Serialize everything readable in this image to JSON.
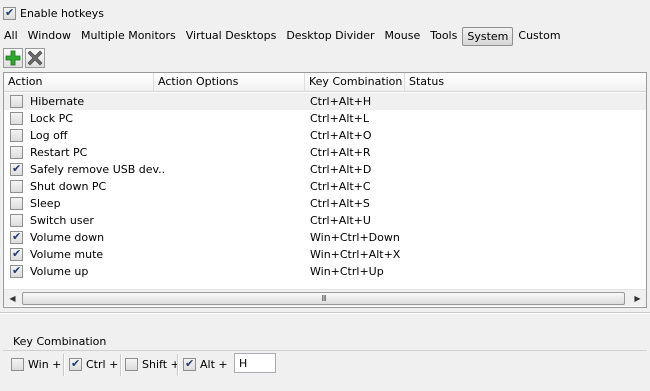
{
  "enable_hotkeys": {
    "label": "Enable hotkeys",
    "checked": true
  },
  "tabs": [
    {
      "label": "All",
      "active": false
    },
    {
      "label": "Window",
      "active": false
    },
    {
      "label": "Multiple Monitors",
      "active": false
    },
    {
      "label": "Virtual Desktops",
      "active": false
    },
    {
      "label": "Desktop Divider",
      "active": false
    },
    {
      "label": "Mouse",
      "active": false
    },
    {
      "label": "Tools",
      "active": false
    },
    {
      "label": "System",
      "active": true
    },
    {
      "label": "Custom",
      "active": false
    }
  ],
  "toolbar": {
    "add_icon": "plus-icon",
    "add_color": "#2eaa2e",
    "delete_icon": "x-icon",
    "delete_color": "#555555"
  },
  "grid": {
    "columns": [
      "Action",
      "Action Options",
      "Key Combination",
      "Status"
    ],
    "rows": [
      {
        "action": "Hibernate",
        "key": "Ctrl+Alt+H",
        "checked": false,
        "selected": true
      },
      {
        "action": "Lock PC",
        "key": "Ctrl+Alt+L",
        "checked": false,
        "selected": false
      },
      {
        "action": "Log off",
        "key": "Ctrl+Alt+O",
        "checked": false,
        "selected": false
      },
      {
        "action": "Restart PC",
        "key": "Ctrl+Alt+R",
        "checked": false,
        "selected": false
      },
      {
        "action": "Safely remove USB dev...",
        "key": "Ctrl+Alt+D",
        "checked": true,
        "selected": false
      },
      {
        "action": "Shut down PC",
        "key": "Ctrl+Alt+C",
        "checked": false,
        "selected": false
      },
      {
        "action": "Sleep",
        "key": "Ctrl+Alt+S",
        "checked": false,
        "selected": false
      },
      {
        "action": "Switch user",
        "key": "Ctrl+Alt+U",
        "checked": false,
        "selected": false
      },
      {
        "action": "Volume down",
        "key": "Win+Ctrl+Down",
        "checked": true,
        "selected": false
      },
      {
        "action": "Volume mute",
        "key": "Win+Ctrl+Alt+X",
        "checked": true,
        "selected": false
      },
      {
        "action": "Volume up",
        "key": "Win+Ctrl+Up",
        "checked": true,
        "selected": false
      }
    ],
    "scrollbar_grip": "III"
  },
  "key_combination": {
    "title": "Key Combination",
    "modifiers": [
      {
        "label": "Win +",
        "checked": false
      },
      {
        "label": "Ctrl +",
        "checked": true
      },
      {
        "label": "Shift +",
        "checked": false
      },
      {
        "label": "Alt +",
        "checked": true
      }
    ],
    "key_value": "H"
  }
}
